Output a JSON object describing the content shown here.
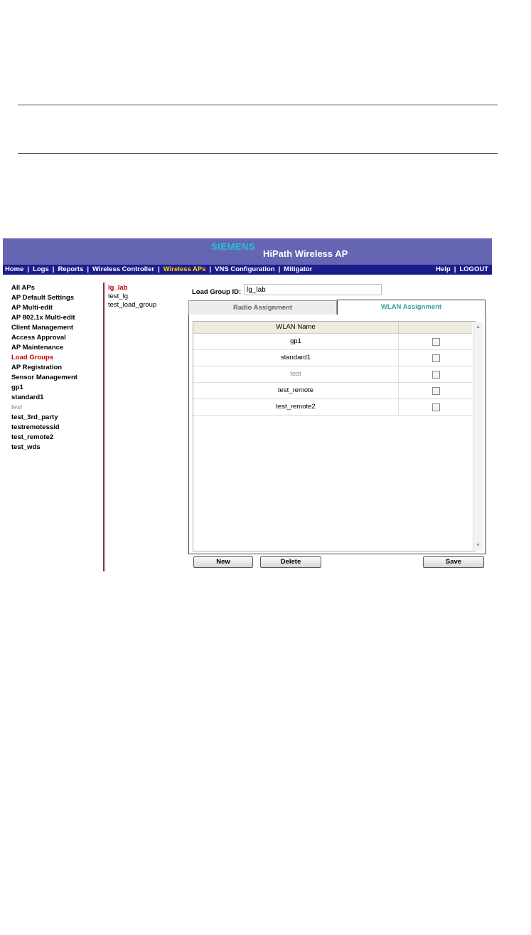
{
  "header": {
    "brand": "SIEMENS",
    "product": "HiPath Wireless AP"
  },
  "nav": {
    "items": [
      {
        "label": "Home"
      },
      {
        "label": "Logs"
      },
      {
        "label": "Reports"
      },
      {
        "label": "Wireless Controller"
      },
      {
        "label": "Wireless APs",
        "active": true
      },
      {
        "label": "VNS Configuration"
      },
      {
        "label": "Mitigator"
      }
    ],
    "right": [
      {
        "label": "Help"
      },
      {
        "label": "LOGOUT"
      }
    ]
  },
  "sidebar": {
    "items": [
      {
        "label": "All APs"
      },
      {
        "label": "AP Default Settings"
      },
      {
        "label": "AP Multi-edit"
      },
      {
        "label": "AP 802.1x Multi-edit"
      },
      {
        "label": "Client Management"
      },
      {
        "label": "Access Approval"
      },
      {
        "label": "AP Maintenance"
      },
      {
        "label": "Load Groups",
        "active": true
      },
      {
        "label": "AP Registration"
      },
      {
        "label": "Sensor Management"
      },
      {
        "label": "gp1"
      },
      {
        "label": "standard1"
      },
      {
        "label": "test",
        "muted": true
      },
      {
        "label": "test_3rd_party"
      },
      {
        "label": "testremotessid"
      },
      {
        "label": "test_remote2"
      },
      {
        "label": "test_wds"
      }
    ]
  },
  "load_groups": {
    "items": [
      {
        "label": "lg_lab",
        "active": true
      },
      {
        "label": "test_lg"
      },
      {
        "label": "test_load_group"
      }
    ]
  },
  "form": {
    "load_group_id_label": "Load Group ID:",
    "load_group_id_value": "lg_lab"
  },
  "tabs": {
    "radio": "Radio Assignment",
    "wlan": "WLAN Assignment",
    "active": "wlan"
  },
  "table": {
    "header": "WLAN Name",
    "rows": [
      {
        "name": "gp1",
        "checked": false
      },
      {
        "name": "standard1",
        "checked": false
      },
      {
        "name": "test",
        "checked": false,
        "muted": true
      },
      {
        "name": "test_remote",
        "checked": false
      },
      {
        "name": "test_remote2",
        "checked": false
      }
    ]
  },
  "buttons": {
    "new": "New",
    "delete": "Delete",
    "save": "Save"
  }
}
